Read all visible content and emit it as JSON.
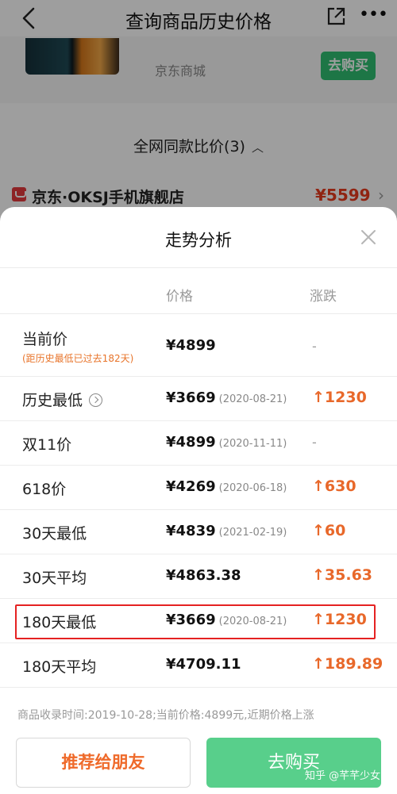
{
  "header": {
    "title": "查询商品历史价格"
  },
  "product": {
    "shop": "京东商城",
    "buy_label": "去购买"
  },
  "compare": {
    "title": "全网同款比价(3)",
    "caret": "︿",
    "shop_name": "京东·OKSJ手机旗舰店",
    "shop_price": "¥5599",
    "chevron": "›"
  },
  "sheet": {
    "title": "走势分析",
    "col_price": "价格",
    "col_change": "涨跌",
    "rows": [
      {
        "label": "当前价",
        "sub": "(距历史最低已过去182天)",
        "price": "¥4899",
        "date": "",
        "change": "-"
      },
      {
        "label": "历史最低",
        "price": "¥3669",
        "date": "(2020-08-21)",
        "change": "↑1230"
      },
      {
        "label": "双11价",
        "price": "¥4899",
        "date": "(2020-11-11)",
        "change": "-"
      },
      {
        "label": "618价",
        "price": "¥4269",
        "date": "(2020-06-18)",
        "change": "↑630"
      },
      {
        "label": "30天最低",
        "price": "¥4839",
        "date": "(2021-02-19)",
        "change": "↑60"
      },
      {
        "label": "30天平均",
        "price": "¥4863.38",
        "date": "",
        "change": "↑35.63"
      },
      {
        "label": "180天最低",
        "price": "¥3669",
        "date": "(2020-08-21)",
        "change": "↑1230"
      },
      {
        "label": "180天平均",
        "price": "¥4709.11",
        "date": "",
        "change": "↑189.89"
      }
    ],
    "footer_note": "商品收录时间:2019-10-28;当前价格:4899元,近期价格上涨",
    "recommend_label": "推荐给朋友",
    "buy_label": "去购买",
    "watermark": "知乎 @芊芊少女"
  },
  "colors": {
    "accent_green": "#2fbf71",
    "rise_orange": "#e8682a",
    "highlight_red": "#e52222"
  }
}
